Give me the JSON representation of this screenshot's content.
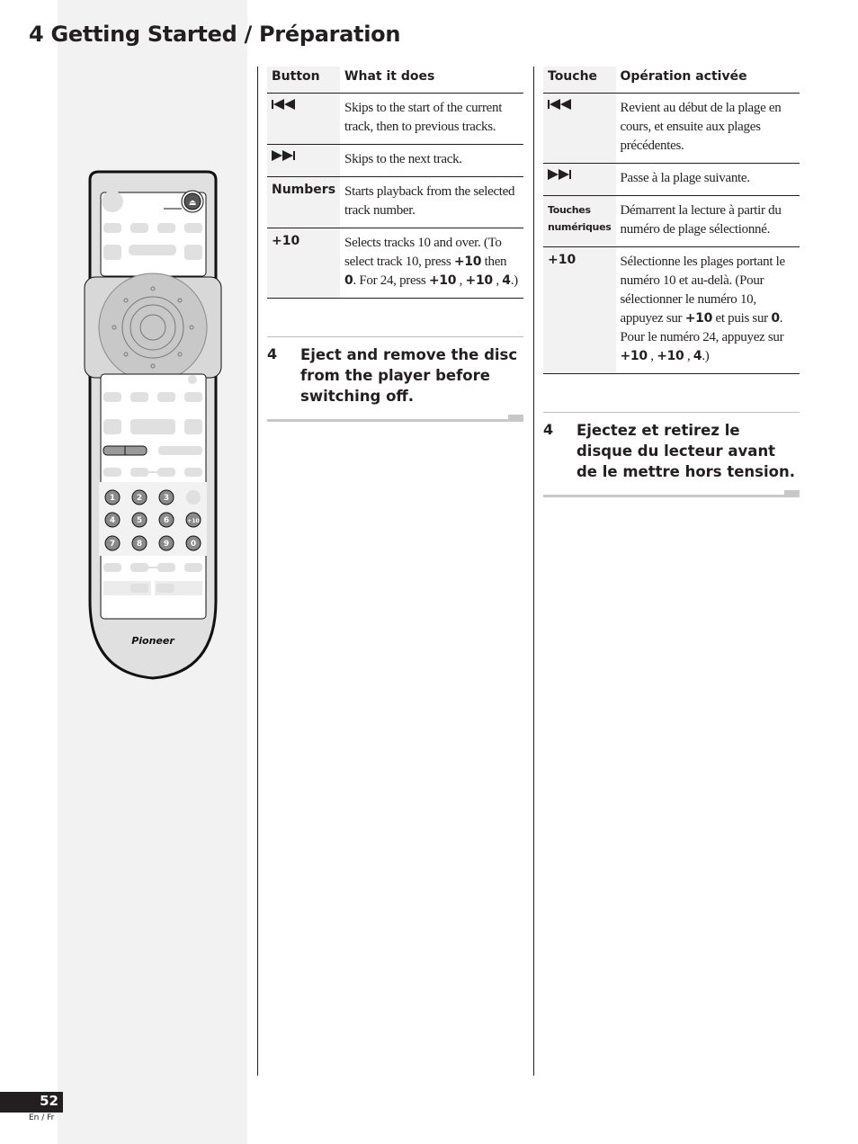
{
  "page": {
    "title": "4 Getting Started / Préparation",
    "page_number": "52",
    "language_label": "En / Fr"
  },
  "english": {
    "table": {
      "headers": [
        "Button",
        "What it does"
      ],
      "rows": [
        {
          "button_icon": "skip-back-icon",
          "button": "",
          "desc": "Skips to the start of the current track, then to previous tracks."
        },
        {
          "button_icon": "skip-forward-icon",
          "button": "",
          "desc": "Skips to the next track."
        },
        {
          "button_icon": "",
          "button": "Numbers",
          "desc": "Starts playback from the selected track number."
        },
        {
          "button_icon": "",
          "button": "+10",
          "desc_parts": [
            "Selects tracks 10 and over. (To select track 10, press ",
            "+10",
            " then ",
            "0",
            ". For 24, press ",
            "+10",
            " , ",
            "+10",
            " , ",
            "4",
            ".)"
          ]
        }
      ]
    },
    "step": {
      "number": "4",
      "text": "Eject and remove the disc from the player before switching off."
    }
  },
  "french": {
    "table": {
      "headers": [
        "Touche",
        "Opération activée"
      ],
      "rows": [
        {
          "button_icon": "skip-back-icon",
          "button": "",
          "desc": "Revient au début de la plage en cours, et ensuite aux plages précédentes."
        },
        {
          "button_icon": "skip-forward-icon",
          "button": "",
          "desc": "Passe à la plage suivante."
        },
        {
          "button_icon": "",
          "button_line1": "Touches",
          "button_line2": "numériques",
          "desc": "Démarrent la lecture à partir du numéro de plage sélectionné."
        },
        {
          "button_icon": "",
          "button": "+10",
          "desc_parts": [
            "Sélectionne les plages portant le numéro 10 et au-delà. (Pour sélectionner le numéro 10, appuyez sur ",
            "+10",
            " et puis sur ",
            "0",
            ". Pour le numéro 24, appuyez sur ",
            "+10",
            " , ",
            "+10",
            " , ",
            "4",
            ".)"
          ]
        }
      ]
    },
    "step": {
      "number": "4",
      "text": "Ejectez et retirez le disque du lecteur avant de le mettre hors tension."
    }
  },
  "remote": {
    "brand": "Pioneer",
    "eject_symbol": "⏏",
    "number_keys": [
      "1",
      "2",
      "3",
      "",
      "4",
      "5",
      "6",
      "+10",
      "7",
      "8",
      "9",
      "0"
    ],
    "skip_keys": [
      "⏮",
      "⏭"
    ]
  },
  "colors": {
    "text": "#231f20",
    "sidebar": "#f2f2f2",
    "remote_body": "#e0e0e0",
    "key_dark": "#8a8a8a"
  }
}
